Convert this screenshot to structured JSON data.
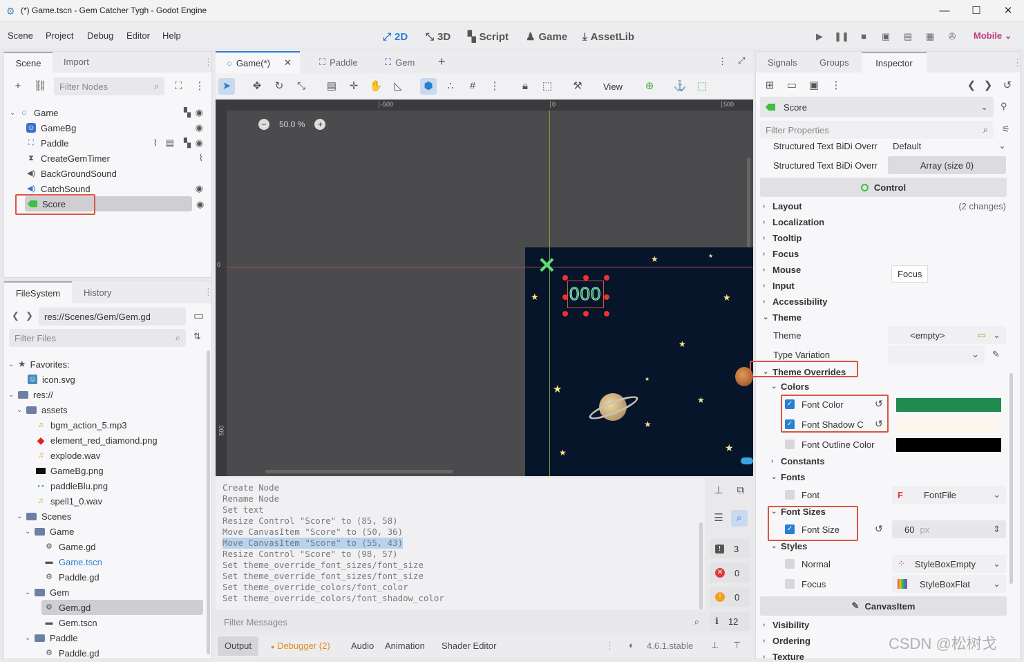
{
  "window": {
    "title": "(*) Game.tscn - Gem Catcher Tygh - Godot Engine",
    "min": "—",
    "max": "☐",
    "close": "✕"
  },
  "menu": [
    "Scene",
    "Project",
    "Debug",
    "Editor",
    "Help"
  ],
  "workspaces": [
    {
      "label": "2D",
      "icon": "2d-icon"
    },
    {
      "label": "3D",
      "icon": "3d-icon"
    },
    {
      "label": "Script",
      "icon": "script-icon"
    },
    {
      "label": "Game",
      "icon": "game-icon"
    },
    {
      "label": "AssetLib",
      "icon": "assetlib-icon"
    }
  ],
  "renderer": "Mobile",
  "scene_dock": {
    "tabs": [
      "Scene",
      "Import"
    ],
    "filter_placeholder": "Filter Nodes",
    "nodes": [
      {
        "name": "Game",
        "icon": "node2d-icon"
      },
      {
        "name": "GameBg",
        "icon": "sprite-icon"
      },
      {
        "name": "Paddle",
        "icon": "area2d-icon"
      },
      {
        "name": "CreateGemTimer",
        "icon": "timer-icon"
      },
      {
        "name": "BackGroundSound",
        "icon": "audio-icon"
      },
      {
        "name": "CatchSound",
        "icon": "audio-icon"
      },
      {
        "name": "Score",
        "icon": "label-icon"
      }
    ]
  },
  "filesystem": {
    "tabs": [
      "FileSystem",
      "History"
    ],
    "path": "res://Scenes/Gem/Gem.gd",
    "filter_placeholder": "Filter Files",
    "items": [
      {
        "label": "Favorites:",
        "type": "star"
      },
      {
        "label": "icon.svg",
        "type": "image"
      },
      {
        "label": "res://",
        "type": "folder"
      },
      {
        "label": "assets",
        "type": "folder"
      },
      {
        "label": "bgm_action_5.mp3",
        "type": "audio"
      },
      {
        "label": "element_red_diamond.png",
        "type": "image"
      },
      {
        "label": "explode.wav",
        "type": "audio"
      },
      {
        "label": "GameBg.png",
        "type": "image"
      },
      {
        "label": "paddleBlu.png",
        "type": "image"
      },
      {
        "label": "spell1_0.wav",
        "type": "audio"
      },
      {
        "label": "Scenes",
        "type": "folder"
      },
      {
        "label": "Game",
        "type": "folder"
      },
      {
        "label": "Game.gd",
        "type": "script"
      },
      {
        "label": "Game.tscn",
        "type": "scene"
      },
      {
        "label": "Paddle.gd",
        "type": "script"
      },
      {
        "label": "Gem",
        "type": "folder"
      },
      {
        "label": "Gem.gd",
        "type": "script"
      },
      {
        "label": "Gem.tscn",
        "type": "scene"
      },
      {
        "label": "Paddle",
        "type": "folder"
      },
      {
        "label": "Paddle.gd",
        "type": "script"
      }
    ]
  },
  "scene_tabs": [
    "Game(*)",
    "Paddle",
    "Gem"
  ],
  "viewport": {
    "view_menu": "View",
    "zoom": "50.0 %",
    "ruler_labels": [
      "-500",
      "0",
      "500"
    ],
    "ruler_left_labels": [
      "0",
      "500"
    ],
    "score_text": "000"
  },
  "output": {
    "lines": [
      "Create Node",
      "Rename Node",
      "Set text",
      "Resize Control \"Score\" to (85, 58)",
      "Move CanvasItem \"Score\" to (50, 36)",
      "Move CanvasItem \"Score\" to (55, 43)",
      "Resize Control \"Score\" to (98, 57)",
      "Set theme_override_font_sizes/font_size",
      "Set theme_override_font_sizes/font_size",
      "Set theme_override_colors/font_color",
      "Set theme_override_colors/font_shadow_color"
    ],
    "highlighted_line": 5,
    "filter_placeholder": "Filter Messages",
    "counts": {
      "errors": "3",
      "warnings": "0",
      "info": "0",
      "messages": "12"
    }
  },
  "bottom_tabs": [
    "Output",
    "Debugger (2)",
    "Audio",
    "Animation",
    "Shader Editor"
  ],
  "version": "4.6.1.stable",
  "inspector": {
    "tabs": [
      "Signals",
      "Groups",
      "Inspector"
    ],
    "object": "Score",
    "filter_placeholder": "Filter Properties",
    "bidi_label1": "Structured Text BiDi Overr",
    "bidi_value1": "Default",
    "bidi_label2": "Structured Text BiDi Overr",
    "bidi_value2": "Array (size 0)",
    "control_header": "Control",
    "sections": [
      {
        "label": "Layout",
        "note": "(2 changes)"
      },
      {
        "label": "Localization",
        "note": ""
      },
      {
        "label": "Tooltip",
        "note": ""
      },
      {
        "label": "Focus",
        "note": ""
      },
      {
        "label": "Mouse",
        "note": ""
      },
      {
        "label": "Input",
        "note": ""
      },
      {
        "label": "Accessibility",
        "note": ""
      }
    ],
    "focus_tooltip": "Focus",
    "theme_label": "Theme",
    "theme_prop": "Theme",
    "theme_value": "<empty>",
    "type_variation": "Type Variation",
    "theme_overrides": "Theme Overrides",
    "colors": "Colors",
    "font_color": {
      "label": "Font Color",
      "color": "#218a4f"
    },
    "font_shadow": {
      "label": "Font Shadow C",
      "color": "#fbf7ec"
    },
    "font_outline": {
      "label": "Font Outline Color",
      "color": "#000000"
    },
    "constants": "Constants",
    "fonts": "Fonts",
    "font": {
      "label": "Font",
      "value": "FontFile"
    },
    "font_sizes": "Font Sizes",
    "font_size": {
      "label": "Font Size",
      "value": "60",
      "unit": "px"
    },
    "styles": "Styles",
    "normal": {
      "label": "Normal",
      "value": "StyleBoxEmpty"
    },
    "focus": {
      "label": "Focus",
      "value": "StyleBoxFlat"
    },
    "canvasitem_header": "CanvasItem",
    "lower_sections": [
      "Visibility",
      "Ordering",
      "Texture"
    ]
  },
  "watermark": "CSDN @松树戈"
}
